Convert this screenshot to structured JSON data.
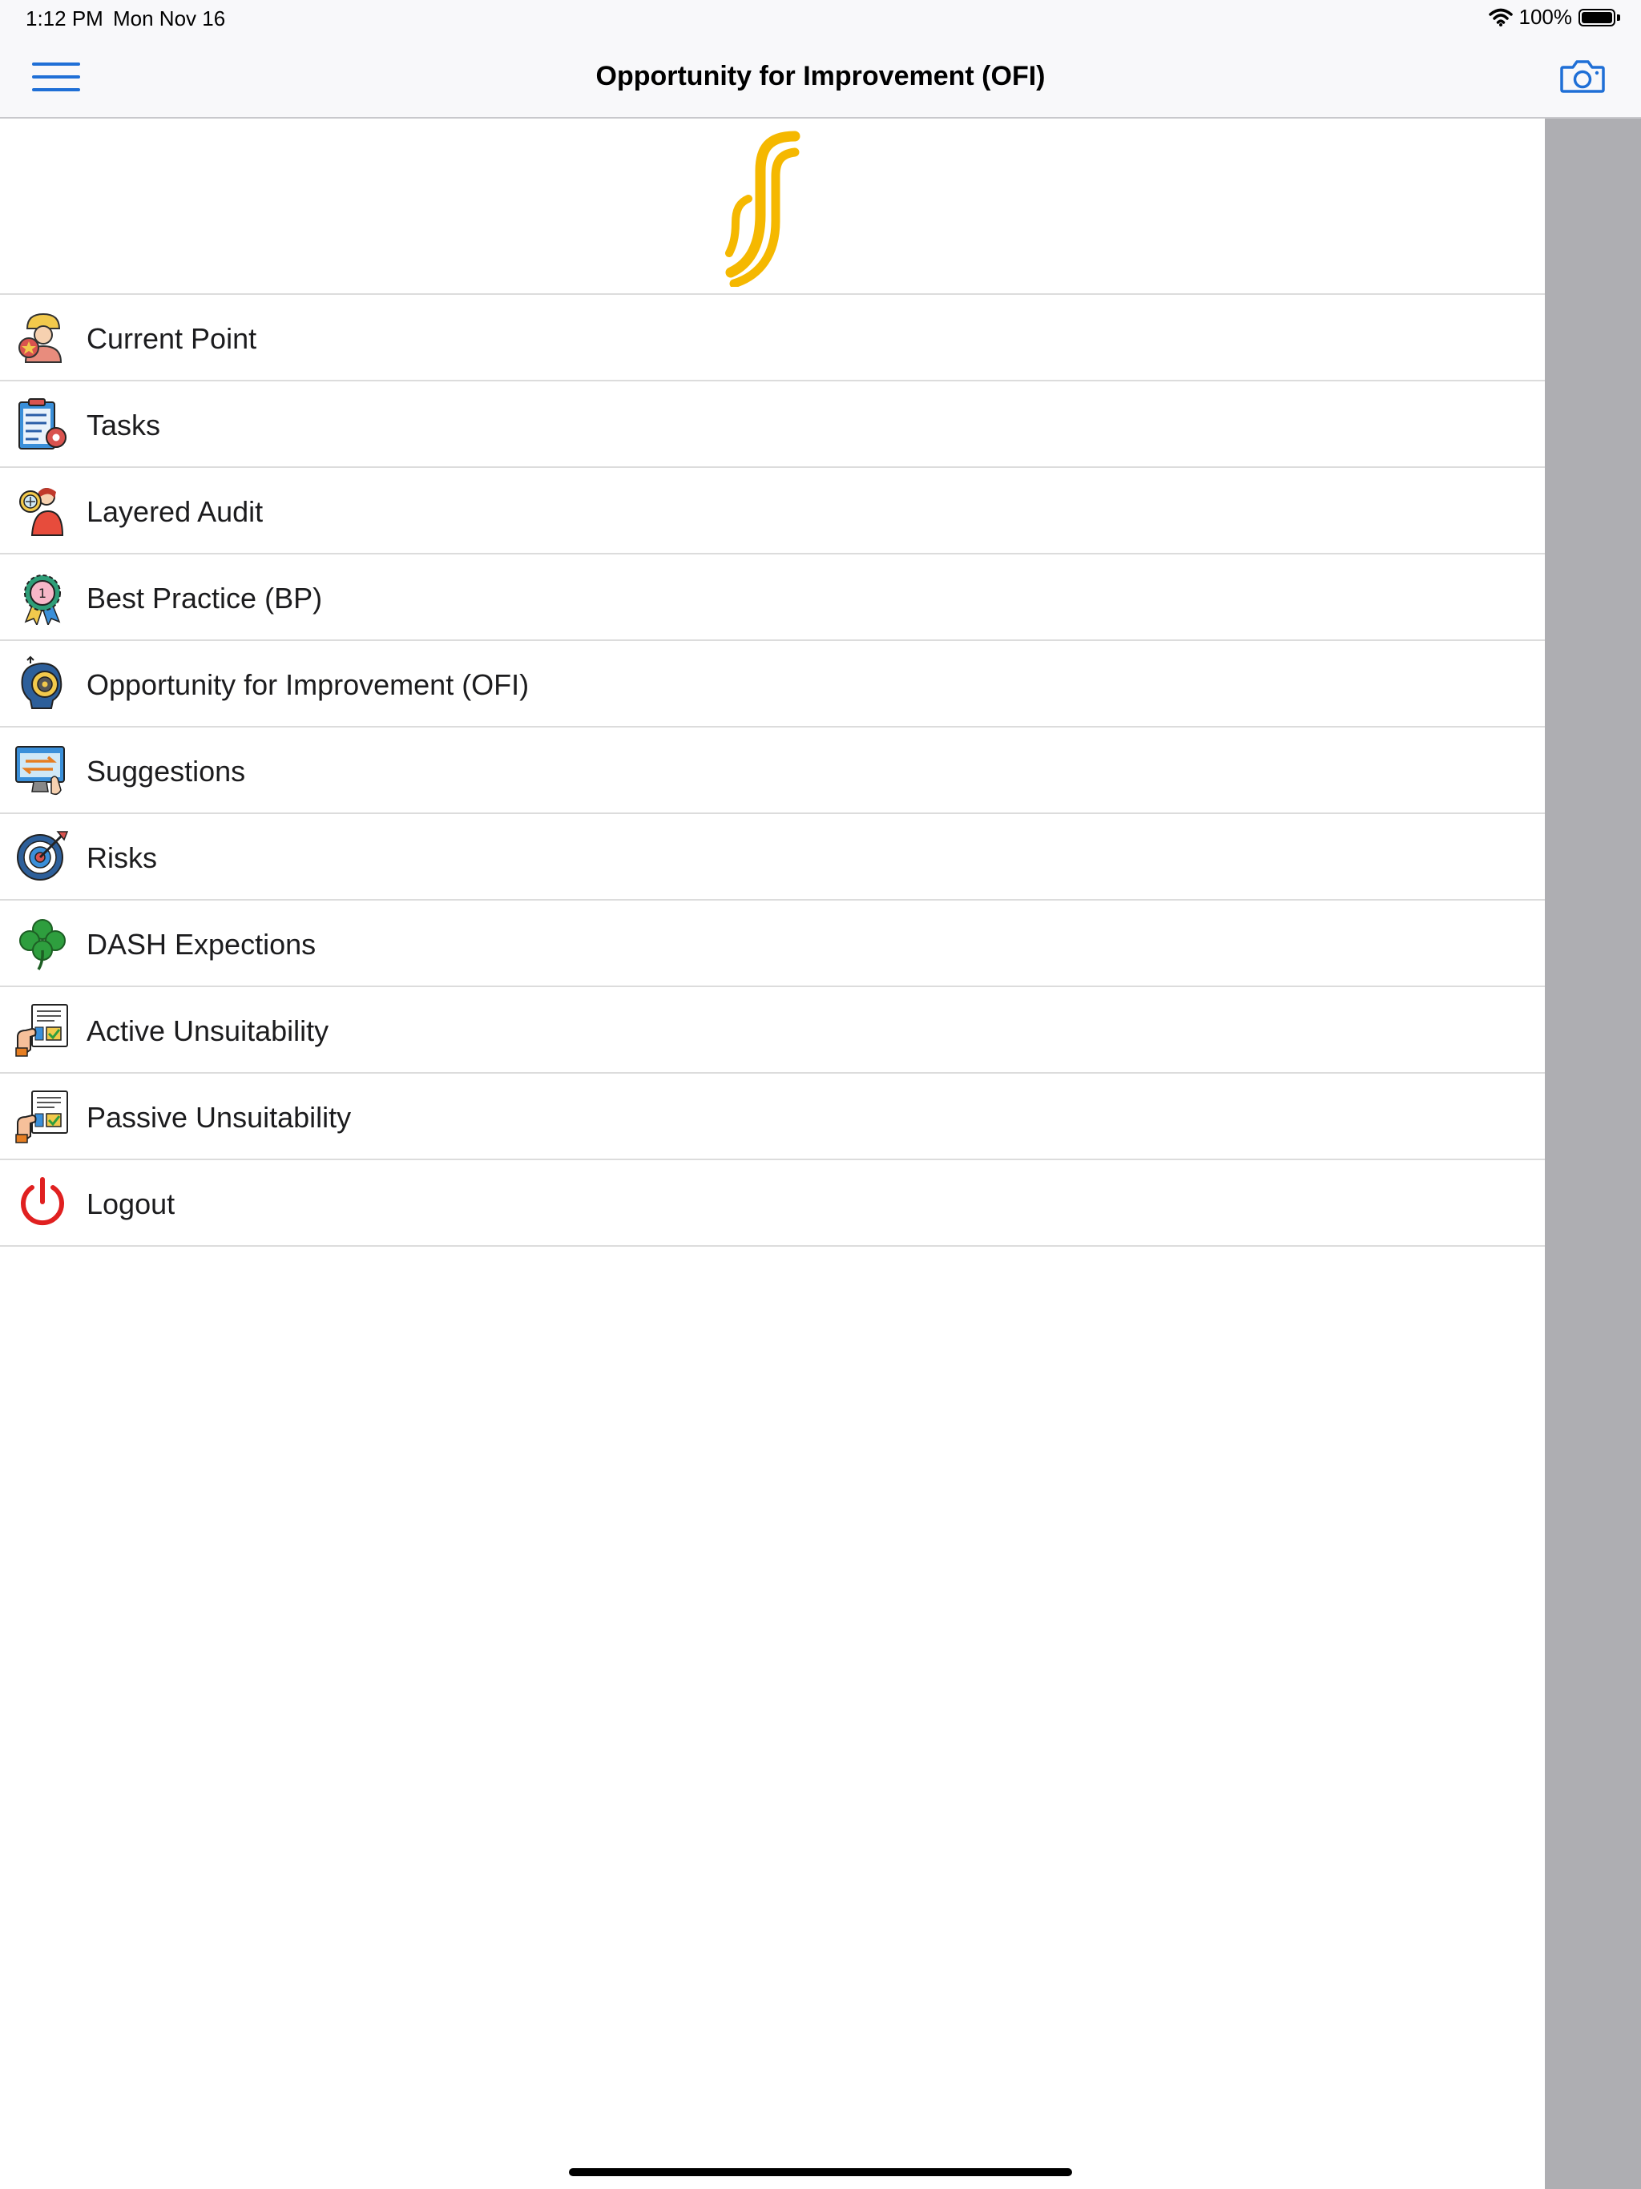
{
  "status_bar": {
    "time": "1:12 PM",
    "date": "Mon Nov 16",
    "battery": "100%"
  },
  "nav": {
    "title": "Opportunity for Improvement (OFI)",
    "accent_color": "#1f6fd6"
  },
  "logo": {
    "color": "#f5b800",
    "icon": "brand-s-logo"
  },
  "menu": {
    "items": [
      {
        "label": "Current Point",
        "icon": "worker-star-icon"
      },
      {
        "label": "Tasks",
        "icon": "checklist-gear-icon"
      },
      {
        "label": "Layered Audit",
        "icon": "magnifier-person-icon"
      },
      {
        "label": "Best Practice (BP)",
        "icon": "award-medal-icon"
      },
      {
        "label": "Opportunity for Improvement (OFI)",
        "icon": "head-gear-icon"
      },
      {
        "label": "Suggestions",
        "icon": "monitor-exchange-icon"
      },
      {
        "label": "Risks",
        "icon": "target-arrow-icon"
      },
      {
        "label": "DASH Expections",
        "icon": "clover-icon"
      },
      {
        "label": "Active Unsuitability",
        "icon": "document-hand-icon"
      },
      {
        "label": "Passive Unsuitability",
        "icon": "document-hand-icon"
      },
      {
        "label": "Logout",
        "icon": "power-icon"
      }
    ]
  }
}
